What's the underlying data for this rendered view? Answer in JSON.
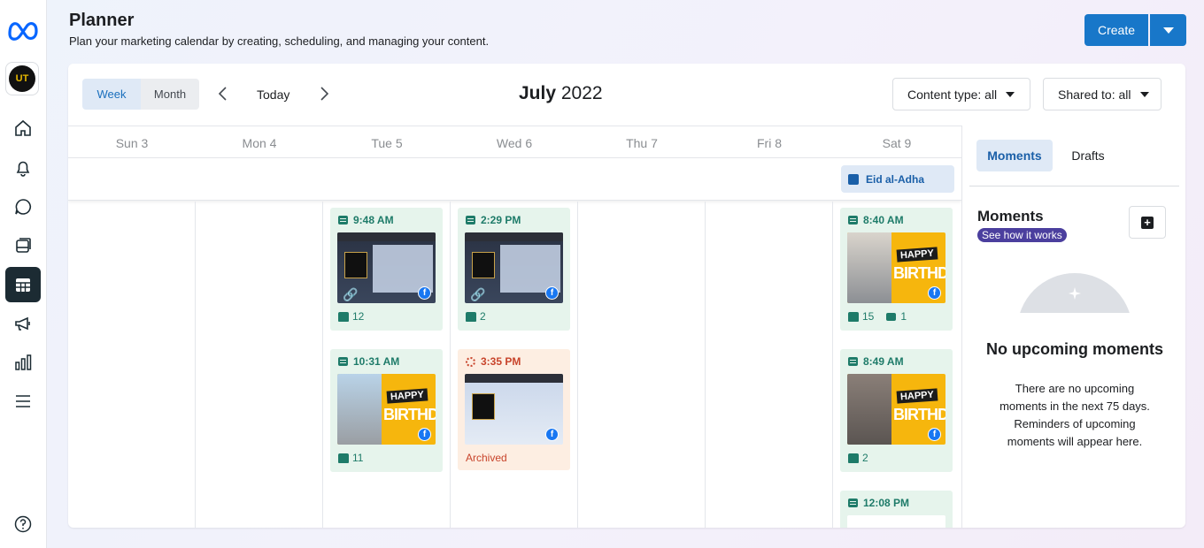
{
  "header": {
    "title": "Planner",
    "subtitle": "Plan your marketing calendar by creating, scheduling, and managing your content.",
    "create_label": "Create"
  },
  "rail": {
    "account_initials": "UT",
    "icons": [
      "home-icon",
      "notifications-icon",
      "messages-icon",
      "posts-icon",
      "planner-icon",
      "ads-icon",
      "insights-icon",
      "menu-icon",
      "help-icon"
    ]
  },
  "toolbar": {
    "view_week": "Week",
    "view_month": "Month",
    "today": "Today",
    "month_name": "July",
    "year": "2022",
    "content_type": "Content type: all",
    "shared_to": "Shared to: all"
  },
  "calendar": {
    "days": [
      "Sun 3",
      "Mon 4",
      "Tue 5",
      "Wed 6",
      "Thu 7",
      "Fri 8",
      "Sat 9"
    ],
    "all_day_event": "Eid al-Adha",
    "posts": [
      {
        "day": "Tue 5",
        "time": "9:48 AM",
        "status": "published",
        "likes": "12",
        "comments": "",
        "thumb": "certificate"
      },
      {
        "day": "Tue 5",
        "time": "10:31 AM",
        "status": "published",
        "likes": "11",
        "comments": "",
        "thumb": "birthday"
      },
      {
        "day": "Wed 6",
        "time": "2:29 PM",
        "status": "published",
        "likes": "2",
        "comments": "",
        "thumb": "certificate"
      },
      {
        "day": "Wed 6",
        "time": "3:35 PM",
        "status": "archived",
        "label": "Archived",
        "thumb": "certificate"
      },
      {
        "day": "Sat 9",
        "time": "8:40 AM",
        "status": "published",
        "likes": "15",
        "comments": "1",
        "thumb": "birthday"
      },
      {
        "day": "Sat 9",
        "time": "8:49 AM",
        "status": "published",
        "likes": "2",
        "comments": "",
        "thumb": "birthday"
      },
      {
        "day": "Sat 9",
        "time": "12:08 PM",
        "status": "published",
        "thumb": "text"
      }
    ],
    "thumb_text": {
      "happy": "HAPPY",
      "birthday": "BIRTHDAY"
    }
  },
  "panel": {
    "tab_moments": "Moments",
    "tab_drafts": "Drafts",
    "heading": "Moments",
    "how_link": "See how it works",
    "empty_title": "No upcoming moments",
    "empty_body": "There are no upcoming moments in the next 75 days. Reminders of upcoming moments will appear here."
  },
  "colors": {
    "accent": "#1877c9",
    "published_bg": "#e6f4ec",
    "published_text": "#1e7b69",
    "archived_bg": "#fdeee2",
    "archived_text": "#c8442b",
    "badge": "#4b3f9e"
  }
}
